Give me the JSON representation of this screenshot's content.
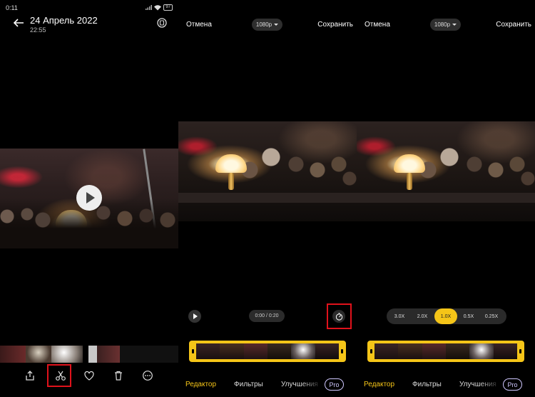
{
  "panel1": {
    "status_time": "0:11",
    "battery": "97",
    "date": "24 Апрель 2022",
    "time": "22:55",
    "toolbar": [
      "share-icon",
      "scissors-icon",
      "heart-icon",
      "trash-icon",
      "more-icon"
    ]
  },
  "panel2": {
    "cancel": "Отмена",
    "save": "Сохранить",
    "resolution": "1080p",
    "time_display": "0:00 / 0:20",
    "tabs": [
      "Редактор",
      "Фильтры",
      "Улучшения"
    ],
    "pro": "Pro"
  },
  "panel3": {
    "cancel": "Отмена",
    "save": "Сохранить",
    "resolution": "1080p",
    "speeds": [
      "3.0X",
      "2.0X",
      "1.0X",
      "0.5X",
      "0.25X"
    ],
    "selected_speed": "1.0X",
    "tabs": [
      "Редактор",
      "Фильтры",
      "Улучшения"
    ],
    "pro": "Pro"
  },
  "colors": {
    "accent": "#f5c518",
    "highlight": "#e0121b",
    "pro": "#d0c8ff"
  }
}
